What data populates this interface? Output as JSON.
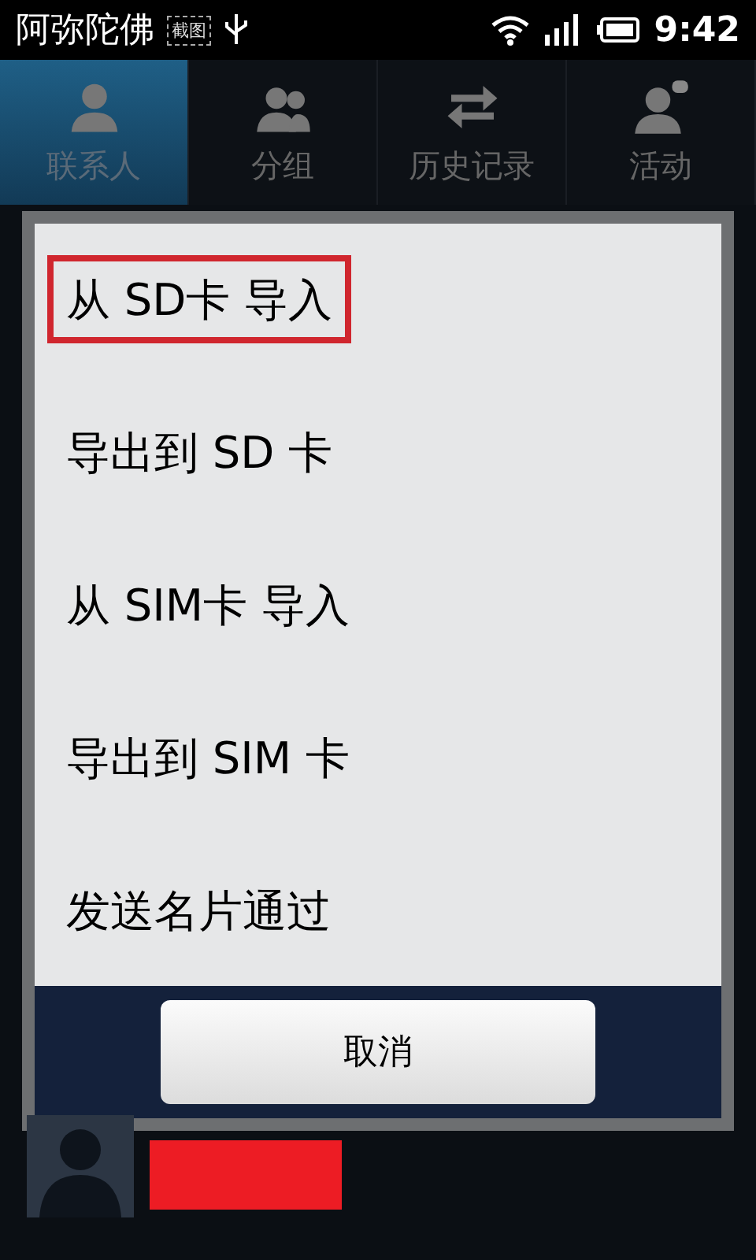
{
  "status_bar": {
    "title": "阿弥陀佛",
    "badge": "截图",
    "time": "9:42"
  },
  "tabs": [
    {
      "label": "联系人",
      "kind": "person",
      "selected": true
    },
    {
      "label": "分组",
      "kind": "group",
      "selected": false
    },
    {
      "label": "历史记录",
      "kind": "arrows",
      "selected": false
    },
    {
      "label": "活动",
      "kind": "activity",
      "selected": false
    }
  ],
  "dialog": {
    "items": [
      {
        "label": "从 SD卡 导入",
        "highlighted": true
      },
      {
        "label": "导出到 SD 卡",
        "highlighted": false
      },
      {
        "label": "从 SIM卡 导入",
        "highlighted": false
      },
      {
        "label": "导出到 SIM 卡",
        "highlighted": false
      },
      {
        "label": "发送名片通过",
        "highlighted": false
      }
    ],
    "button": "取消"
  },
  "contact_below": {
    "redacted": true
  }
}
